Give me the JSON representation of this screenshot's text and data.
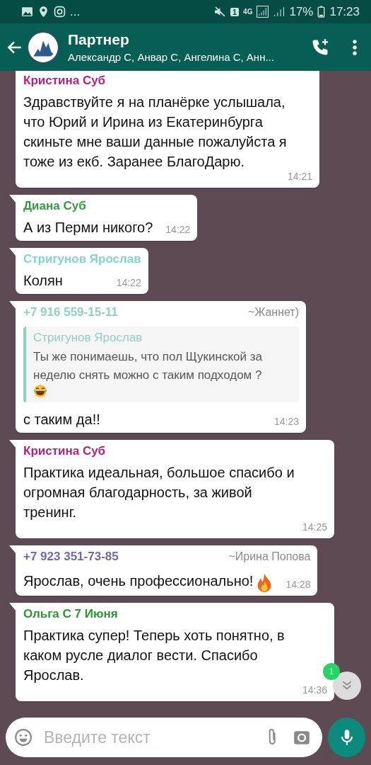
{
  "status_bar": {
    "more": "...",
    "sim": "1",
    "network": "4G",
    "battery": "17%",
    "time": "17:23"
  },
  "header": {
    "title": "Партнер",
    "subtitle": "Александр С, Анвар С, Ангелина С, Анн..."
  },
  "messages": [
    {
      "sender": "Кристина Суб",
      "color": "#b0247f",
      "text": "Здравствуйте я на планёрке услышала, что Юрий и Ирина из Екатеринбурга скиньте мне ваши данные пожалуйста я тоже из екб. Заранее БлагоДарю.",
      "time": "14:21",
      "tail": false
    },
    {
      "sender": "Диана Суб",
      "color": "#2f9d3e",
      "text": "А из Перми никого?",
      "time": "14:22",
      "tail": true
    },
    {
      "sender": "Стригунов Ярослав",
      "color": "#86d5c4",
      "text": "Колян",
      "time": "14:22",
      "tail": true
    },
    {
      "sender": "+7 916 559-15-11",
      "color": "#8ed2c2",
      "push_name": "~Жаннет)",
      "quote": {
        "sender": "Стригунов Ярослав",
        "color": "#8ed2c2",
        "text": "Ты же понимаешь, что пол Щукинской за неделю снять можно с таким подходом ?",
        "kind": "emoji"
      },
      "text": "с таким да!!",
      "time": "14:23",
      "tail": true
    },
    {
      "sender": "Кристина Суб",
      "color": "#b0247f",
      "text": "Практика идеальная, большое спасибо и огромная благодарность, за живой тренинг.",
      "time": "14:25",
      "tail": true
    },
    {
      "sender": "+7 923 351-73-85",
      "color": "#6d6bb0",
      "push_name": "~Ирина Попова",
      "text": "Ярослав, очень профессионально!",
      "kind": "emoji",
      "time": "14:28",
      "tail": true
    },
    {
      "sender": "Ольга С 7 Июня",
      "color": "#2a9a2e",
      "text": "Практика супер! Теперь хоть понятно, в каком русле диалог вести. Спасибо Ярослав.",
      "time": "14:36",
      "tail": true
    }
  ],
  "scroll_badge": "1",
  "composer": {
    "placeholder": "Введите текст"
  }
}
